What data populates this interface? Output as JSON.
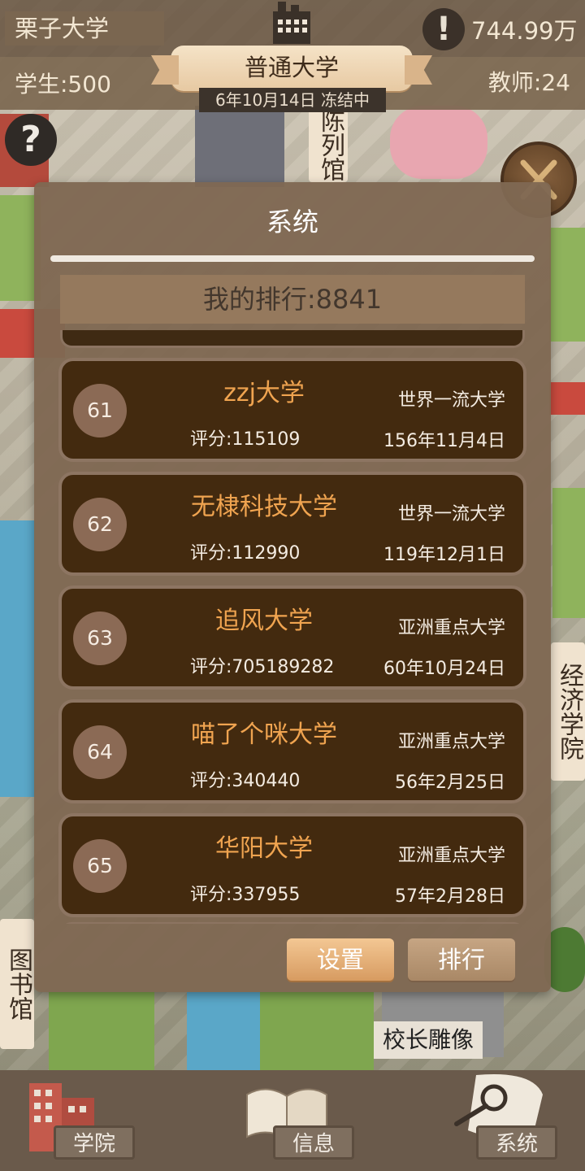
{
  "header": {
    "university_name": "栗子大学",
    "money": "744.99万",
    "students": "学生:500",
    "teachers": "教师:24",
    "level": "普通大学",
    "date_status": "6年10月14日 冻结中"
  },
  "map_labels": {
    "exhibition": "陈列馆",
    "economics": "经济学院",
    "library": "图书馆",
    "statue": "校长雕像"
  },
  "dialog": {
    "title": "系统",
    "my_rank": "我的排行:8841",
    "settings_label": "设置",
    "ranking_label": "排行",
    "entries": [
      {
        "rank": "61",
        "name": "zzj大学",
        "score": "评分:115109",
        "tier": "世界一流大学",
        "founded": "156年11月4日"
      },
      {
        "rank": "62",
        "name": "无棣科技大学",
        "score": "评分:112990",
        "tier": "世界一流大学",
        "founded": "119年12月1日"
      },
      {
        "rank": "63",
        "name": "追风大学",
        "score": "评分:705189282",
        "tier": "亚洲重点大学",
        "founded": "60年10月24日"
      },
      {
        "rank": "64",
        "name": "喵了个咪大学",
        "score": "评分:340440",
        "tier": "亚洲重点大学",
        "founded": "56年2月25日"
      },
      {
        "rank": "65",
        "name": "华阳大学",
        "score": "评分:337955",
        "tier": "亚洲重点大学",
        "founded": "57年2月28日"
      }
    ]
  },
  "bottom_nav": {
    "college": "学院",
    "info": "信息",
    "system": "系统"
  },
  "colors": {
    "card_bg": "#432a0f",
    "name_orange": "#f0a450",
    "dialog_bg": "#7f6852"
  }
}
